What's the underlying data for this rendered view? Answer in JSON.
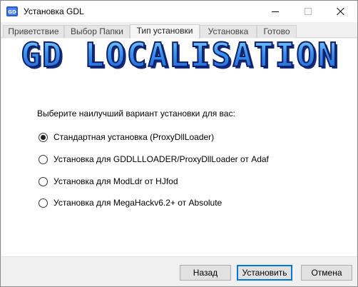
{
  "window": {
    "title": "Установка GDL",
    "controls": [
      "minimize",
      "maximize",
      "close"
    ]
  },
  "tabs": [
    {
      "label": "Приветствие",
      "active": false
    },
    {
      "label": "Выбор Папки",
      "active": false
    },
    {
      "label": "Тип установки",
      "active": true
    },
    {
      "label": "Установка",
      "active": false
    },
    {
      "label": "Готово",
      "active": false
    }
  ],
  "banner": {
    "text": "GD LOCALISATION",
    "colors": {
      "fill": "#2f7fe0",
      "shadow": "#1a2f86",
      "highlight": "#8ed6ff"
    }
  },
  "content": {
    "prompt": "Выберите наилучший вариант установки для вас:",
    "options": [
      {
        "label": "Стандартная установка (ProxyDllLoader)",
        "checked": true
      },
      {
        "label": "Установка для GDDLLLOADER/ProxyDllLoader от Adaf",
        "checked": false
      },
      {
        "label": "Установка для ModLdr от HJfod",
        "checked": false
      },
      {
        "label": "Установка для MegaHackv6.2+ от Absolute",
        "checked": false
      }
    ]
  },
  "footer": {
    "back_label": "Назад",
    "install_label": "Установить",
    "cancel_label": "Отмена"
  },
  "icons": {
    "app": "gdl-app-icon",
    "minimize": "minimize-icon",
    "maximize": "maximize-icon",
    "close": "close-icon"
  }
}
